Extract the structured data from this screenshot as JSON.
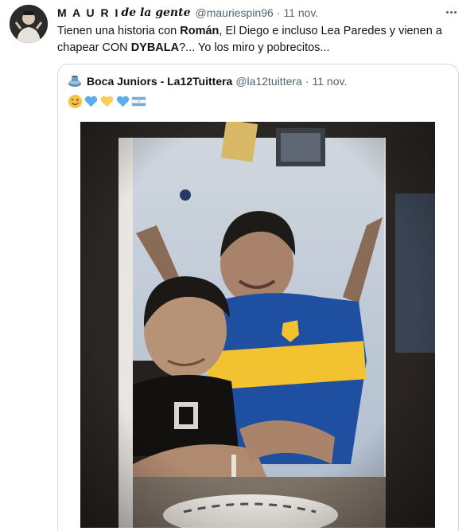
{
  "tweet": {
    "author": {
      "display_name_main": "M A U R I",
      "display_name_fancy": "de la gente",
      "handle": "@mauriespin96",
      "avatar_icon": "user-avatar"
    },
    "separator": "·",
    "time": "11 nov.",
    "text": {
      "part1": "Tienen una historia con ",
      "bold1": "Román",
      "part2": ", El Diego e incluso Lea Paredes y vienen a chapear CON ",
      "bold2": "DYBALA",
      "part3": "?... Yo los miro y pobrecitos..."
    },
    "more_icon": "more-horizontal-icon"
  },
  "quote": {
    "author": {
      "display_name": "Boca Juniors - La12Tuittera",
      "handle": "@la12tuittera",
      "avatar_icon": "stadium-avatar"
    },
    "separator": "·",
    "time": "11 nov.",
    "emojis": [
      "winking-face",
      "blue-heart",
      "yellow-heart",
      "blue-heart",
      "argentina-flag"
    ],
    "photo": "old-photo-two-boys-boca-jersey"
  },
  "colors": {
    "text_primary": "#0f1419",
    "text_secondary": "#536471",
    "border": "#cfd9de",
    "boca_blue": "#1f4fa0",
    "boca_yellow": "#f2c230"
  }
}
